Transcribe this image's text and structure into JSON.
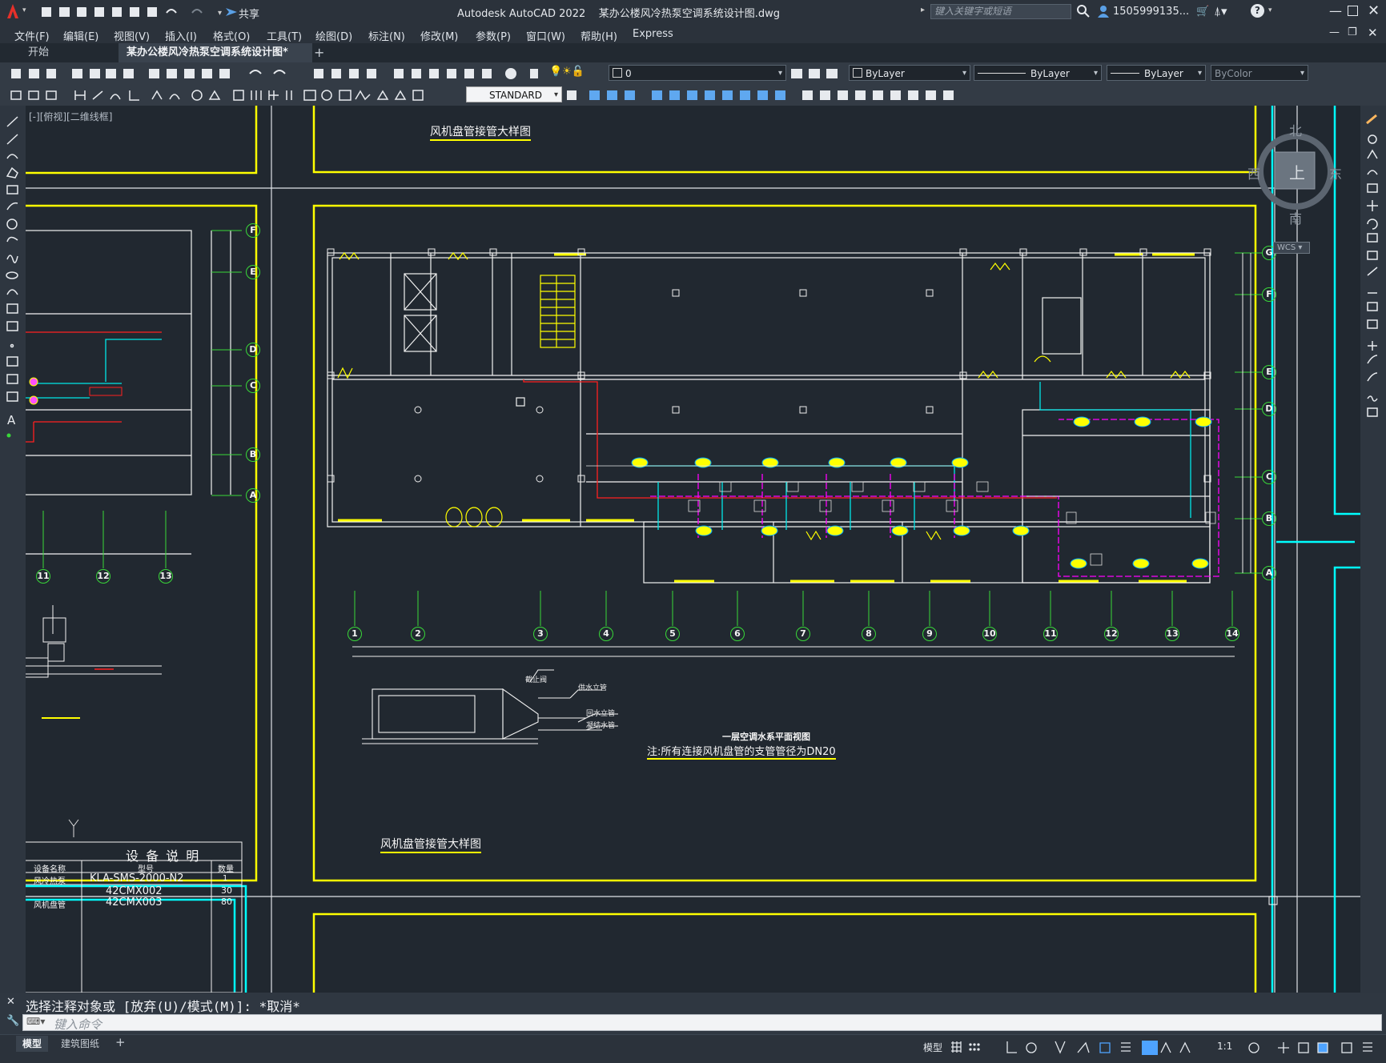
{
  "app": {
    "title": "Autodesk AutoCAD 2022",
    "filename": "某办公楼风冷热泵空调系统设计图.dwg",
    "share_label": "共享",
    "search_placeholder": "键入关键字或短语",
    "user": "1505999135...",
    "help": "?"
  },
  "menu": [
    "文件(F)",
    "编辑(E)",
    "视图(V)",
    "插入(I)",
    "格式(O)",
    "工具(T)",
    "绘图(D)",
    "标注(N)",
    "修改(M)",
    "参数(P)",
    "窗口(W)",
    "帮助(H)",
    "Express"
  ],
  "tabs": {
    "start": "开始",
    "active": "某办公楼风冷热泵空调系统设计图*",
    "close": "×",
    "add": "+"
  },
  "toolbar": {
    "layer": "0",
    "color": "ByLayer",
    "linetype": "ByLayer",
    "lineweight": "ByLayer",
    "plotstyle": "ByColor",
    "textstyle": "STANDARD"
  },
  "viewport": {
    "label": "[-][俯视][二维线框]",
    "compass": {
      "n": "北",
      "s": "南",
      "e": "东",
      "w": "西",
      "top": "上",
      "wcs": "WCS"
    }
  },
  "drawing": {
    "title_top": "风机盘管接管大样图",
    "plan_title": "一层空调水系平面视图",
    "note": "注:所有连接风机盘管的支管管径为DN20",
    "detail_title": "风机盘管接管大样图",
    "label_valve": "截止阀",
    "label_supply": "供水立管",
    "label_return": "回水立管",
    "label_drain": "凝结水管",
    "equipment_table": {
      "title": "设 备 说 明",
      "headers": [
        "设备名称",
        "型号",
        "数量"
      ],
      "rows": [
        [
          "风冷热泵",
          "KLA-SMS-2000-N2",
          "1"
        ],
        [
          "",
          "42CMX002",
          "30"
        ],
        [
          "风机盘管",
          "42CMX003",
          "80"
        ]
      ]
    },
    "axis_numbers": [
      "1",
      "2",
      "3",
      "4",
      "5",
      "6",
      "7",
      "8",
      "9",
      "10",
      "11",
      "12",
      "13",
      "14"
    ],
    "axis_letters": [
      "G",
      "F",
      "E",
      "D",
      "C",
      "B",
      "A"
    ],
    "left_axis_letters": [
      "F",
      "E",
      "D",
      "C",
      "B",
      "A"
    ],
    "left_axis_numbers": [
      "11",
      "12",
      "13"
    ]
  },
  "command": {
    "history": "选择注释对象或 [放弃(U)/模式(M)]: *取消*",
    "placeholder": "键入命令"
  },
  "status": {
    "model_tab": "模型",
    "layout_tab": "建筑图纸",
    "add": "+",
    "model": "模型",
    "scale": "1:1"
  }
}
